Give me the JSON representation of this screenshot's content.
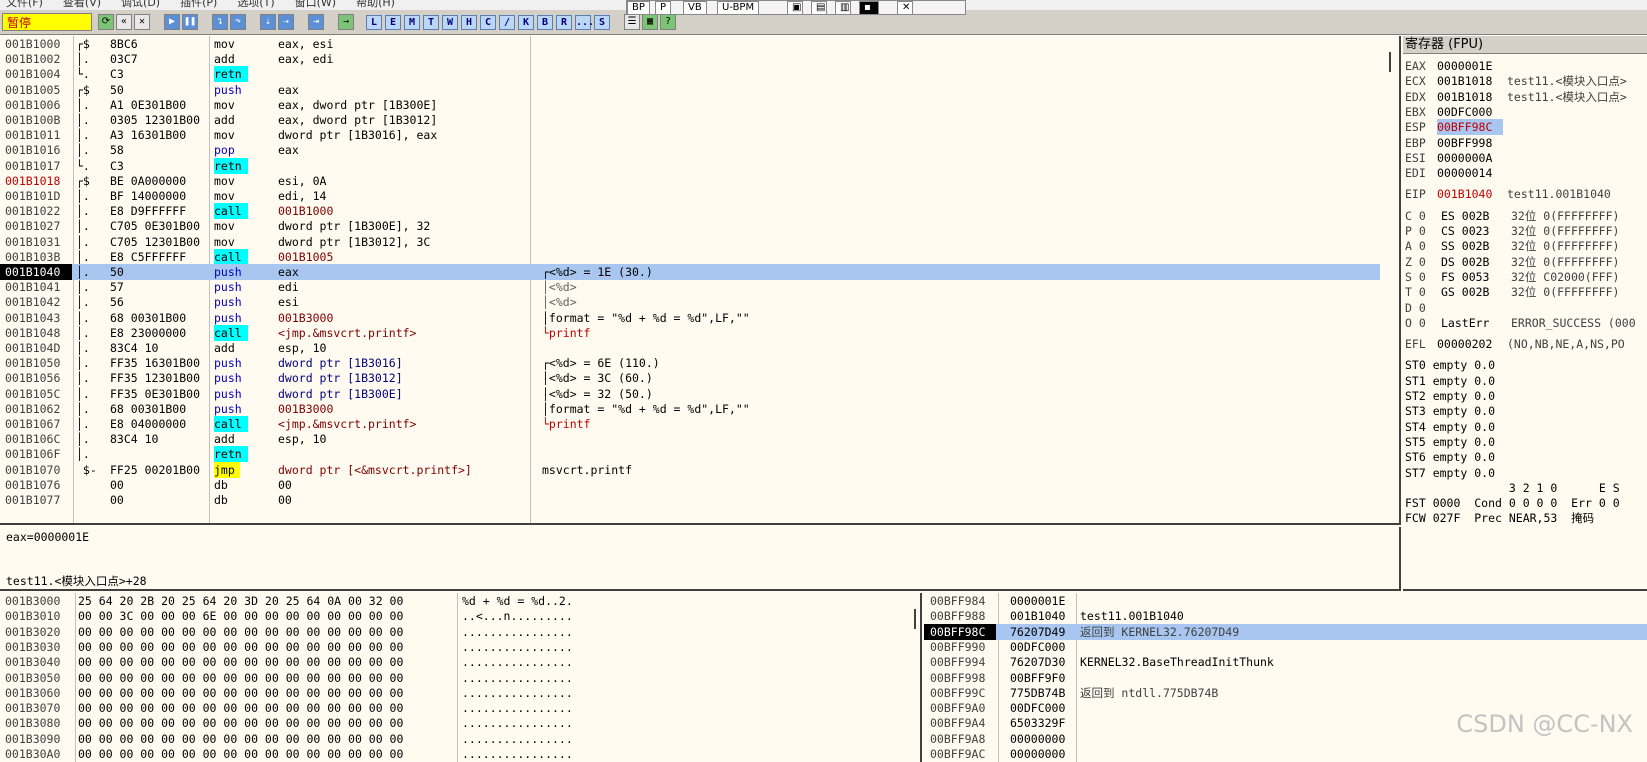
{
  "menu": [
    "文件(F)",
    "查看(V)",
    "调试(D)",
    "插件(P)",
    "选项(T)",
    "窗口(W)",
    "帮助(H)"
  ],
  "status": "暂停",
  "toolbar_letters": [
    "L",
    "E",
    "M",
    "T",
    "W",
    "H",
    "C",
    "/",
    "K",
    "B",
    "R",
    "...",
    "S"
  ],
  "float_buttons": [
    "BP",
    "P",
    "VB",
    "U-BPM"
  ],
  "disasm": [
    {
      "addr": "001B1000",
      "mark": "┌$",
      "hex": "8BC6",
      "mn": "mov",
      "op": "eax, esi",
      "cm": ""
    },
    {
      "addr": "001B1002",
      "mark": "│.",
      "hex": "03C7",
      "mn": "add",
      "op": "eax, edi",
      "cm": ""
    },
    {
      "addr": "001B1004",
      "mark": "└.",
      "hex": "C3",
      "mn": "retn",
      "op": "",
      "cm": ""
    },
    {
      "addr": "001B1005",
      "mark": "┌$",
      "hex": "50",
      "mn": "push",
      "op": "eax",
      "cm": ""
    },
    {
      "addr": "001B1006",
      "mark": "│.",
      "hex": "A1 0E301B00",
      "mn": "mov",
      "op": "eax, dword ptr [1B300E]",
      "cm": ""
    },
    {
      "addr": "001B100B",
      "mark": "│.",
      "hex": "0305 12301B00",
      "mn": "add",
      "op": "eax, dword ptr [1B3012]",
      "cm": ""
    },
    {
      "addr": "001B1011",
      "mark": "│.",
      "hex": "A3 16301B00",
      "mn": "mov",
      "op": "dword ptr [1B3016], eax",
      "cm": ""
    },
    {
      "addr": "001B1016",
      "mark": "│.",
      "hex": "58",
      "mn": "pop",
      "op": "eax",
      "cm": ""
    },
    {
      "addr": "001B1017",
      "mark": "└.",
      "hex": "C3",
      "mn": "retn",
      "op": "",
      "cm": ""
    },
    {
      "addr": "001B1018",
      "mark": "┌$",
      "hex": "BE 0A000000",
      "mn": "mov",
      "op": "esi, 0A",
      "cm": "",
      "red": true
    },
    {
      "addr": "001B101D",
      "mark": "│.",
      "hex": "BF 14000000",
      "mn": "mov",
      "op": "edi, 14",
      "cm": ""
    },
    {
      "addr": "001B1022",
      "mark": "│.",
      "hex": "E8 D9FFFFFF",
      "mn": "call",
      "op": "001B1000",
      "cm": ""
    },
    {
      "addr": "001B1027",
      "mark": "│.",
      "hex": "C705 0E301B00",
      "mn": "mov",
      "op": "dword ptr [1B300E], 32",
      "cm": ""
    },
    {
      "addr": "001B1031",
      "mark": "│.",
      "hex": "C705 12301B00",
      "mn": "mov",
      "op": "dword ptr [1B3012], 3C",
      "cm": ""
    },
    {
      "addr": "001B103B",
      "mark": "│.",
      "hex": "E8 C5FFFFFF",
      "mn": "call",
      "op": "001B1005",
      "cm": ""
    },
    {
      "addr": "001B1040",
      "mark": "│.",
      "hex": "50",
      "mn": "push",
      "op": "eax",
      "cm": "┌<%d> = 1E (30.)",
      "cur": true
    },
    {
      "addr": "001B1041",
      "mark": "│.",
      "hex": "57",
      "mn": "push",
      "op": "edi",
      "cm": "│<%d>"
    },
    {
      "addr": "001B1042",
      "mark": "│.",
      "hex": "56",
      "mn": "push",
      "op": "esi",
      "cm": "│<%d>"
    },
    {
      "addr": "001B1043",
      "mark": "│.",
      "hex": "68 00301B00",
      "mn": "push",
      "op": "001B3000",
      "cm": "│format = \"%d + %d = %d\",LF,\"\""
    },
    {
      "addr": "001B1048",
      "mark": "│.",
      "hex": "E8 23000000",
      "mn": "call",
      "op": "<jmp.&msvcrt.printf>",
      "cm": "└printf"
    },
    {
      "addr": "001B104D",
      "mark": "│.",
      "hex": "83C4 10",
      "mn": "add",
      "op": "esp, 10",
      "cm": ""
    },
    {
      "addr": "001B1050",
      "mark": "│.",
      "hex": "FF35 16301B00",
      "mn": "push",
      "op": "dword ptr [1B3016]",
      "cm": "┌<%d> = 6E (110.)"
    },
    {
      "addr": "001B1056",
      "mark": "│.",
      "hex": "FF35 12301B00",
      "mn": "push",
      "op": "dword ptr [1B3012]",
      "cm": "│<%d> = 3C (60.)"
    },
    {
      "addr": "001B105C",
      "mark": "│.",
      "hex": "FF35 0E301B00",
      "mn": "push",
      "op": "dword ptr [1B300E]",
      "cm": "│<%d> = 32 (50.)"
    },
    {
      "addr": "001B1062",
      "mark": "│.",
      "hex": "68 00301B00",
      "mn": "push",
      "op": "001B3000",
      "cm": "│format = \"%d + %d = %d\",LF,\"\""
    },
    {
      "addr": "001B1067",
      "mark": "│.",
      "hex": "E8 04000000",
      "mn": "call",
      "op": "<jmp.&msvcrt.printf>",
      "cm": "└printf"
    },
    {
      "addr": "001B106C",
      "mark": "│.",
      "hex": "83C4 10",
      "mn": "add",
      "op": "esp, 10",
      "cm": ""
    },
    {
      "addr": "001B106F",
      "mark": "│.",
      "hex": "",
      "mn": "retn",
      "op": "",
      "cm": ""
    },
    {
      "addr": "001B1070",
      "mark": " $-",
      "hex": "FF25 00201B00",
      "mn": "jmp",
      "op": "dword ptr [<&msvcrt.printf>]",
      "cm": "msvcrt.printf"
    },
    {
      "addr": "001B1076",
      "mark": "",
      "hex": "00",
      "mn": "db",
      "op": "00",
      "cm": ""
    },
    {
      "addr": "001B1077",
      "mark": "",
      "hex": "00",
      "mn": "db",
      "op": "00",
      "cm": ""
    }
  ],
  "info": {
    "line1": "eax=0000001E",
    "line2": "test11.<模块入口点>+28"
  },
  "registers": {
    "title": "寄存器 (FPU)",
    "gpr": [
      {
        "n": "EAX",
        "v": "0000001E",
        "d": ""
      },
      {
        "n": "ECX",
        "v": "001B1018",
        "d": "test11.<模块入口点>"
      },
      {
        "n": "EDX",
        "v": "001B1018",
        "d": "test11.<模块入口点>"
      },
      {
        "n": "EBX",
        "v": "00DFC000",
        "d": ""
      },
      {
        "n": "ESP",
        "v": "00BFF98C",
        "d": "",
        "hl": true
      },
      {
        "n": "EBP",
        "v": "00BFF998",
        "d": ""
      },
      {
        "n": "ESI",
        "v": "0000000A",
        "d": ""
      },
      {
        "n": "EDI",
        "v": "00000014",
        "d": ""
      }
    ],
    "eip": {
      "n": "EIP",
      "v": "001B1040",
      "d": "test11.001B1040"
    },
    "flags": [
      {
        "n": "C 0",
        "v": "ES 002B",
        "d": "32位 0(FFFFFFFF)"
      },
      {
        "n": "P 0",
        "v": "CS 0023",
        "d": "32位 0(FFFFFFFF)"
      },
      {
        "n": "A 0",
        "v": "SS 002B",
        "d": "32位 0(FFFFFFFF)"
      },
      {
        "n": "Z 0",
        "v": "DS 002B",
        "d": "32位 0(FFFFFFFF)"
      },
      {
        "n": "S 0",
        "v": "FS 0053",
        "d": "32位 C02000(FFF)"
      },
      {
        "n": "T 0",
        "v": "GS 002B",
        "d": "32位 0(FFFFFFFF)"
      },
      {
        "n": "D 0",
        "v": "",
        "d": ""
      },
      {
        "n": "O 0",
        "v": "LastErr",
        "d": "ERROR_SUCCESS (000"
      }
    ],
    "efl": {
      "n": "EFL",
      "v": "00000202",
      "d": "(NO,NB,NE,A,NS,PO"
    },
    "st": [
      "ST0 empty 0.0",
      "ST1 empty 0.0",
      "ST2 empty 0.0",
      "ST3 empty 0.0",
      "ST4 empty 0.0",
      "ST5 empty 0.0",
      "ST6 empty 0.0",
      "ST7 empty 0.0"
    ],
    "fpu_hdr": "               3 2 1 0      E S",
    "fst": "FST 0000  Cond 0 0 0 0  Err 0 0",
    "fcw": "FCW 027F  Prec NEAR,53  掩码"
  },
  "dump": [
    {
      "a": "001B3000",
      "h": "25 64 20 2B 20 25 64 20 3D 20 25 64 0A 00 32 00",
      "s": "%d + %d = %d..2."
    },
    {
      "a": "001B3010",
      "h": "00 00 3C 00 00 00 6E 00 00 00 00 00 00 00 00 00",
      "s": "..<...n........."
    },
    {
      "a": "001B3020",
      "h": "00 00 00 00 00 00 00 00 00 00 00 00 00 00 00 00",
      "s": "................"
    },
    {
      "a": "001B3030",
      "h": "00 00 00 00 00 00 00 00 00 00 00 00 00 00 00 00",
      "s": "................"
    },
    {
      "a": "001B3040",
      "h": "00 00 00 00 00 00 00 00 00 00 00 00 00 00 00 00",
      "s": "................"
    },
    {
      "a": "001B3050",
      "h": "00 00 00 00 00 00 00 00 00 00 00 00 00 00 00 00",
      "s": "................"
    },
    {
      "a": "001B3060",
      "h": "00 00 00 00 00 00 00 00 00 00 00 00 00 00 00 00",
      "s": "................"
    },
    {
      "a": "001B3070",
      "h": "00 00 00 00 00 00 00 00 00 00 00 00 00 00 00 00",
      "s": "................"
    },
    {
      "a": "001B3080",
      "h": "00 00 00 00 00 00 00 00 00 00 00 00 00 00 00 00",
      "s": "................"
    },
    {
      "a": "001B3090",
      "h": "00 00 00 00 00 00 00 00 00 00 00 00 00 00 00 00",
      "s": "................"
    },
    {
      "a": "001B30A0",
      "h": "00 00 00 00 00 00 00 00 00 00 00 00 00 00 00 00",
      "s": "................"
    }
  ],
  "stack": [
    {
      "a": "00BFF984",
      "v": "0000001E",
      "c": ""
    },
    {
      "a": "00BFF988",
      "v": "001B1040",
      "c": "test11.001B1040"
    },
    {
      "a": "00BFF98C",
      "v": "76207D49",
      "c": "返回到 KERNEL32.76207D49",
      "cur": true
    },
    {
      "a": "00BFF990",
      "v": "00DFC000",
      "c": ""
    },
    {
      "a": "00BFF994",
      "v": "76207D30",
      "c": "KERNEL32.BaseThreadInitThunk"
    },
    {
      "a": "00BFF998",
      "v": "00BFF9F0",
      "c": ""
    },
    {
      "a": "00BFF99C",
      "v": "775DB74B",
      "c": "返回到 ntdll.775DB74B"
    },
    {
      "a": "00BFF9A0",
      "v": "00DFC000",
      "c": ""
    },
    {
      "a": "00BFF9A4",
      "v": "6503329F",
      "c": ""
    },
    {
      "a": "00BFF9A8",
      "v": "00000000",
      "c": ""
    },
    {
      "a": "00BFF9AC",
      "v": "00000000",
      "c": ""
    }
  ],
  "watermark": "CSDN @CC-NX"
}
